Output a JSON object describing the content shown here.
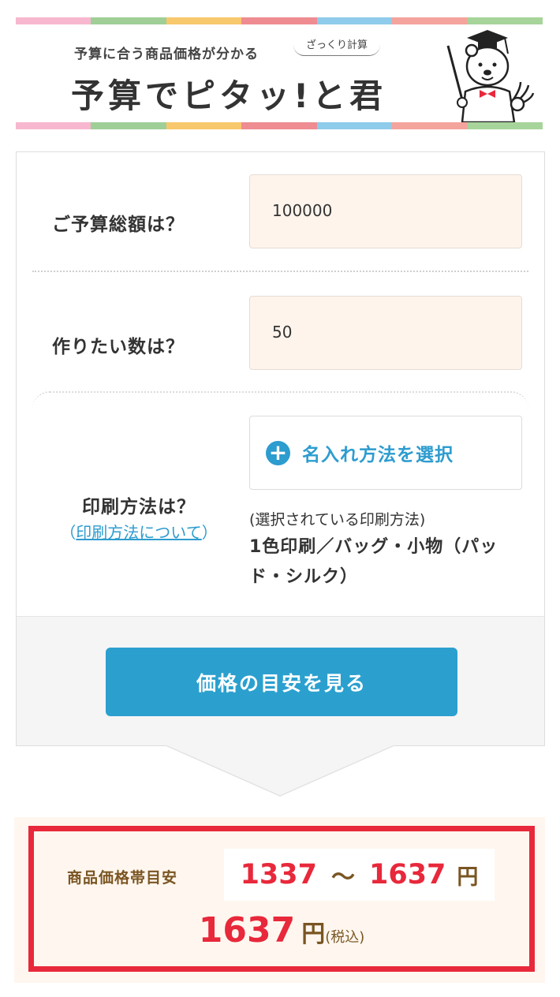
{
  "banner": {
    "tagline": "予算に合う商品価格が分かる",
    "subtag": "ざっくり計算",
    "logo_text": "予算でピタッ!と君",
    "stripe_colors": [
      "#f7b8cf",
      "#9fcf97",
      "#f8c86c",
      "#ee8c91",
      "#8fcbea",
      "#f4a49d",
      "#a7d49a"
    ]
  },
  "form": {
    "budget": {
      "label": "ご予算総額は？",
      "value": "100000"
    },
    "quantity": {
      "label": "作りたい数は？",
      "value": "50"
    },
    "print": {
      "label": "印刷方法は？",
      "link_open": "（",
      "link_text": "印刷方法について",
      "link_close": "）",
      "select_button": "名入れ方法を選択",
      "selected_caption": "(選択されている印刷方法)",
      "selected_value": "1色印刷／バッグ・小物（パッド・シルク）"
    },
    "submit_label": "価格の目安を見る"
  },
  "result": {
    "label": "商品価格帯目安",
    "min": "1337",
    "tilde": "～",
    "max": "1637",
    "yen": "円",
    "total": "1637",
    "total_yen": "円",
    "tax_note": "(税込)"
  },
  "colors": {
    "accent_blue": "#2ba0cf",
    "result_red": "#e8283b",
    "result_brown": "#7a5522",
    "input_bg": "#fff4ec"
  }
}
